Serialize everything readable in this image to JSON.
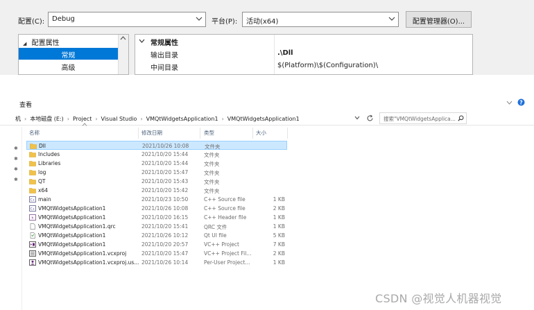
{
  "config_bar": {
    "config_label": "配置(C):",
    "config_value": "Debug",
    "platform_label": "平台(P):",
    "platform_value": "活动(x64)",
    "manager_button": "配置管理器(O)..."
  },
  "tree": {
    "root": "配置属性",
    "items": [
      "常规",
      "高级"
    ]
  },
  "grid": {
    "category": "常规属性",
    "rows": [
      {
        "key": "输出目录",
        "value": ".\\Dll"
      },
      {
        "key": "中间目录",
        "value": "$(Platform)\\$(Configuration)\\"
      }
    ]
  },
  "explorer": {
    "ribbon_view": "查看",
    "breadcrumb": [
      "机",
      "本地磁盘 (E:)",
      "Project",
      "Visual Studio",
      "VMQtWidgetsApplication1",
      "VMQtWidgetsApplication1"
    ],
    "search_placeholder": "搜索\"VMQtWidgetsApplica...",
    "columns": {
      "name": "名称",
      "date": "修改日期",
      "type": "类型",
      "size": "大小"
    },
    "files": [
      {
        "name": "Dll",
        "date": "2021/10/26 10:08",
        "type": "文件夹",
        "size": "",
        "icon": "folder-icon",
        "selected": true
      },
      {
        "name": "Includes",
        "date": "2021/10/20 15:44",
        "type": "文件夹",
        "size": "",
        "icon": "folder-icon"
      },
      {
        "name": "Libraries",
        "date": "2021/10/20 15:44",
        "type": "文件夹",
        "size": "",
        "icon": "folder-icon"
      },
      {
        "name": "log",
        "date": "2021/10/20 15:47",
        "type": "文件夹",
        "size": "",
        "icon": "folder-icon"
      },
      {
        "name": "QT",
        "date": "2021/10/20 15:43",
        "type": "文件夹",
        "size": "",
        "icon": "folder-icon"
      },
      {
        "name": "x64",
        "date": "2021/10/20 15:42",
        "type": "文件夹",
        "size": "",
        "icon": "folder-icon"
      },
      {
        "name": "main",
        "date": "2021/10/23 10:50",
        "type": "C++ Source file",
        "size": "1 KB",
        "icon": "cpp-source-icon"
      },
      {
        "name": "VMQtWidgetsApplication1",
        "date": "2021/10/26 10:08",
        "type": "C++ Source file",
        "size": "2 KB",
        "icon": "cpp-source-icon"
      },
      {
        "name": "VMQtWidgetsApplication1",
        "date": "2021/10/20 16:15",
        "type": "C++ Header file",
        "size": "1 KB",
        "icon": "cpp-header-icon"
      },
      {
        "name": "VMQtWidgetsApplication1.qrc",
        "date": "2021/10/20 15:41",
        "type": "QRC 文件",
        "size": "1 KB",
        "icon": "blank-file-icon"
      },
      {
        "name": "VMQtWidgetsApplication1",
        "date": "2021/10/26 10:12",
        "type": "Qt UI file",
        "size": "5 KB",
        "icon": "qt-ui-file-icon"
      },
      {
        "name": "VMQtWidgetsApplication1",
        "date": "2021/10/20 20:57",
        "type": "VC++ Project",
        "size": "7 KB",
        "icon": "vcxproj-icon"
      },
      {
        "name": "VMQtWidgetsApplication1.vcxproj",
        "date": "2021/10/20 15:47",
        "type": "VC++ Project Fil...",
        "size": "2 KB",
        "icon": "vcxproj-filters-icon"
      },
      {
        "name": "VMQtWidgetsApplication1.vcxproj.us...",
        "date": "2021/10/26 10:14",
        "type": "Per-User Project...",
        "size": "1 KB",
        "icon": "vcxproj-user-icon"
      }
    ]
  },
  "watermark": "CSDN @视觉人机器视觉",
  "colors": {
    "selection": "#cce8ff",
    "tree_selection": "#0078d7",
    "folder": "#f0c24b",
    "help": "#1e6fd9"
  }
}
